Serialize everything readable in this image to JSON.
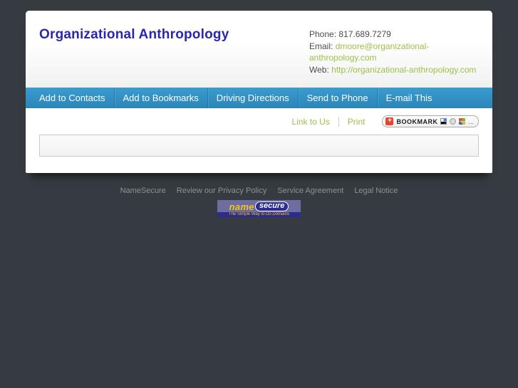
{
  "title": "Organizational Anthropology",
  "contact": {
    "phone_label": "Phone:",
    "phone_value": "817.689.7279",
    "email_label": "Email:",
    "email_value": "dmoore@organizational-anthropology.com",
    "web_label": "Web:",
    "web_value": "http://organizational-anthropology.com"
  },
  "nav": {
    "items": [
      {
        "label": "Add to Contacts"
      },
      {
        "label": "Add to Bookmarks"
      },
      {
        "label": "Driving Directions"
      },
      {
        "label": "Send to Phone"
      },
      {
        "label": "E-mail This"
      }
    ]
  },
  "actions": {
    "link_to_us": "Link to Us",
    "print": "Print",
    "bookmark": {
      "plus": "+",
      "label": "BOOKMARK",
      "more": "..."
    }
  },
  "footer": {
    "links": [
      {
        "label": "NameSecure"
      },
      {
        "label": "Review our Privacy Policy"
      },
      {
        "label": "Service Agreement"
      },
      {
        "label": "Legal Notice"
      }
    ],
    "logo": {
      "name": "name",
      "secure": "secure",
      "tagline": "The Simple Way to Do Domains"
    }
  },
  "colors": {
    "background": "#353b40",
    "nav_blue": "#2e8fc2",
    "link_green": "#9dc049",
    "title_blue": "#2b27ad",
    "footer_gray": "#8c9196",
    "logo_purple": "#6d6da0",
    "logo_navy": "#2b2b92",
    "logo_yellow": "#f5c518",
    "bookmark_red": "#e8432c"
  }
}
